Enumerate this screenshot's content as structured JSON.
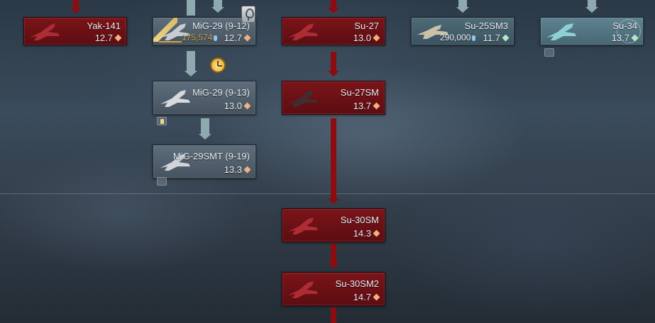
{
  "tree": {
    "yak141": {
      "name": "Yak-141",
      "br": "12.7",
      "status": "locked"
    },
    "mig29_912": {
      "name": "MiG-29 (9-12)",
      "br": "12.7",
      "cost": "175,574",
      "status": "researching",
      "progress": 0.22
    },
    "mig29_913": {
      "name": "MiG-29 (9-13)",
      "br": "13.0",
      "status": "owned"
    },
    "mig29smt": {
      "name": "MiG-29SMT (9-19)",
      "br": "13.3",
      "status": "owned"
    },
    "su27": {
      "name": "Su-27",
      "br": "13.0",
      "status": "locked"
    },
    "su27sm": {
      "name": "Su-27SM",
      "br": "13.7",
      "status": "locked"
    },
    "su30sm": {
      "name": "Su-30SM",
      "br": "14.3",
      "status": "locked"
    },
    "su30sm2": {
      "name": "Su-30SM2",
      "br": "14.7",
      "status": "locked"
    },
    "su25sm3": {
      "name": "Su-25SM3",
      "br": "11.7",
      "cost": "290,000",
      "status": "available"
    },
    "su34": {
      "name": "Su-34",
      "br": "13.7",
      "status": "owned"
    }
  },
  "icons": {
    "rank_diamond": "diamond-icon",
    "research_points": "rp-drop-icon",
    "timer": "timer-clock-icon",
    "wishlist": "pin-icon"
  },
  "colors": {
    "locked": "#6a1015",
    "owned": "#4f5f6c",
    "available": "#3e5a66",
    "research_bar": "#d6a23f",
    "tree_link_locked": "#8d0c10",
    "tree_link_owned": "#8ea9b0"
  }
}
